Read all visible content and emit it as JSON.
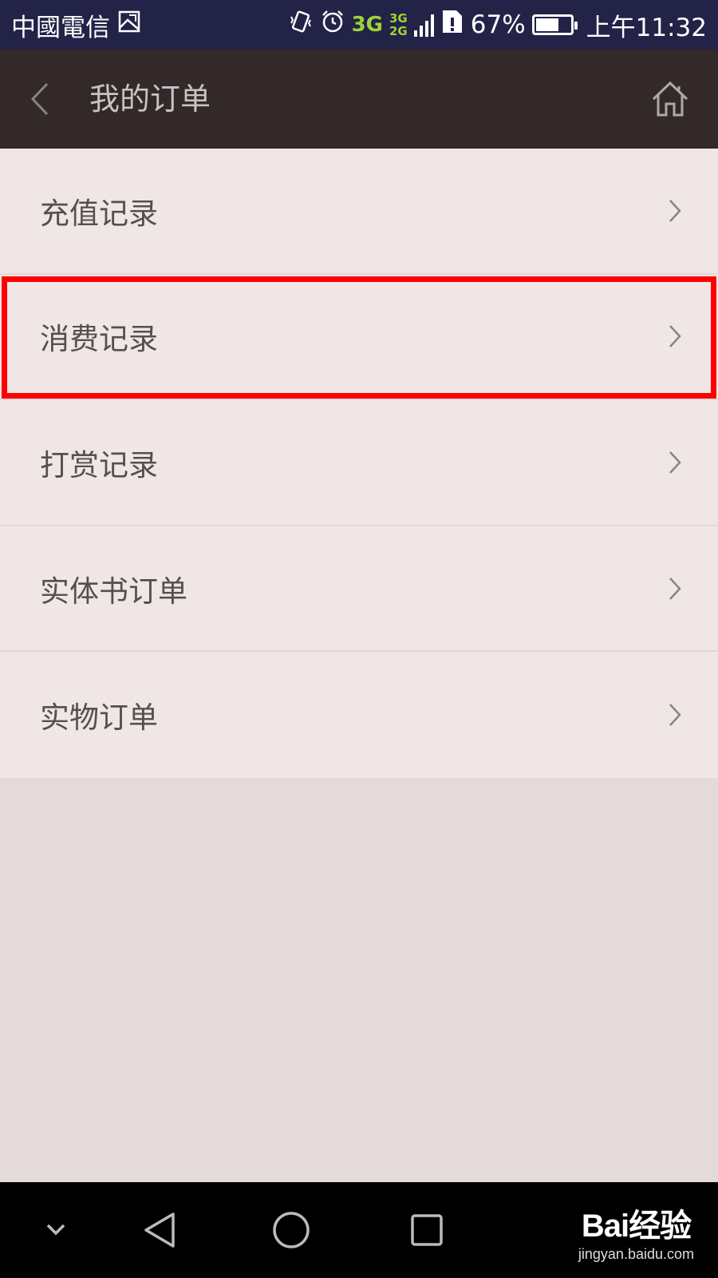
{
  "status_bar": {
    "carrier": "中國電信",
    "network_primary": "3G",
    "network_secondary_top": "3G",
    "network_secondary_bottom": "2G",
    "battery_percent": "67%",
    "battery_level": 0.67,
    "time": "上午11:32",
    "icons": [
      "gallery-icon",
      "vibrate-icon",
      "alarm-icon",
      "signal-icon",
      "sim-alert-icon",
      "battery-icon"
    ]
  },
  "header": {
    "title": "我的订单",
    "back_icon": "chevron-left-icon",
    "home_icon": "home-icon"
  },
  "menu": {
    "items": [
      {
        "label": "充值记录",
        "highlighted": false
      },
      {
        "label": "消费记录",
        "highlighted": true
      },
      {
        "label": "打赏记录",
        "highlighted": false
      },
      {
        "label": "实体书订单",
        "highlighted": false
      },
      {
        "label": "实物订单",
        "highlighted": false
      }
    ]
  },
  "nav_bar": {
    "icons": [
      "hide-keyboard-icon",
      "back-triangle-icon",
      "home-circle-icon",
      "recents-square-icon"
    ]
  },
  "watermark": {
    "logo": "Bai经验",
    "url": "jingyan.baidu.com"
  },
  "colors": {
    "status_bar_bg": "#222347",
    "header_bg": "#33282a",
    "list_bg": "#f0e6e6",
    "page_bg": "#e5dada",
    "highlight": "#ff0000",
    "network_green": "#9fd33a"
  }
}
